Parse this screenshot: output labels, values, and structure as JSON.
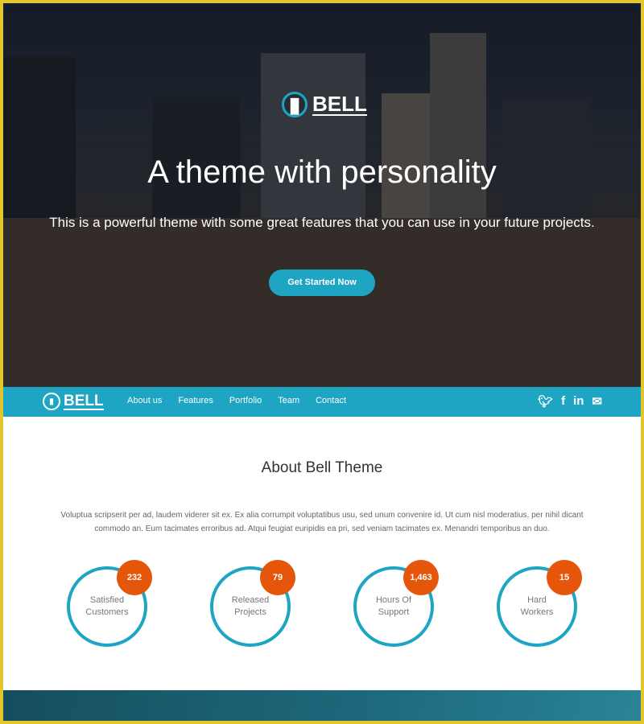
{
  "hero": {
    "brand": "BELL",
    "title": "A theme with personality",
    "subtitle": "This is a powerful theme with some great features that you can use in your future projects.",
    "cta": "Get Started Now"
  },
  "nav": {
    "brand": "BELL",
    "items": [
      {
        "label": "About us"
      },
      {
        "label": "Features"
      },
      {
        "label": "Portfolio"
      },
      {
        "label": "Team"
      },
      {
        "label": "Contact"
      }
    ],
    "social": [
      "twitter-icon",
      "facebook-icon",
      "linkedin-icon",
      "mail-icon"
    ]
  },
  "about": {
    "title": "About Bell Theme",
    "text": "Voluptua scripserit per ad, laudem viderer sit ex. Ex alia corrumpit voluptatibus usu, sed unum convenire id. Ut cum nisl moderatius, per nihil dicant commodo an. Eum tacimates erroribus ad. Atqui feugiat euripidis ea pri, sed veniam tacimates ex. Menandri temporibus an duo.",
    "stats": [
      {
        "value": "232",
        "line1": "Satisfied",
        "line2": "Customers"
      },
      {
        "value": "79",
        "line1": "Released",
        "line2": "Projects"
      },
      {
        "value": "1,463",
        "line1": "Hours Of",
        "line2": "Support"
      },
      {
        "value": "15",
        "line1": "Hard",
        "line2": "Workers"
      }
    ]
  },
  "colors": {
    "accent": "#1ea5c3",
    "badge": "#e5560b",
    "border": "#e3c52c"
  }
}
